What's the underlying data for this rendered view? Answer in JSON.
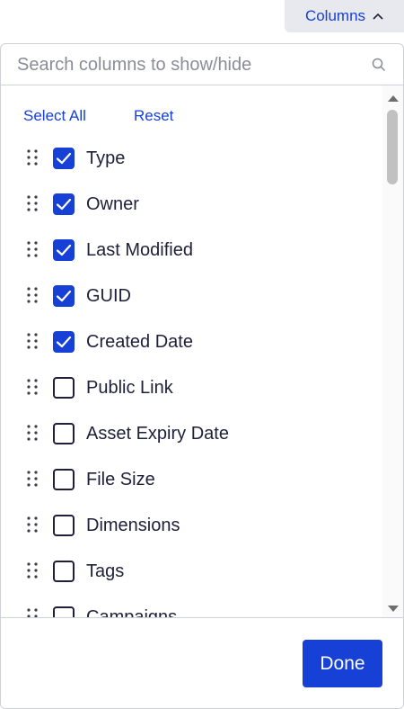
{
  "header": {
    "columns_label": "Columns"
  },
  "search": {
    "placeholder": "Search columns to show/hide",
    "value": ""
  },
  "actions": {
    "select_all": "Select All",
    "reset": "Reset"
  },
  "columns": [
    {
      "label": "Type",
      "checked": true
    },
    {
      "label": "Owner",
      "checked": true
    },
    {
      "label": "Last Modified",
      "checked": true
    },
    {
      "label": "GUID",
      "checked": true
    },
    {
      "label": "Created Date",
      "checked": true
    },
    {
      "label": "Public Link",
      "checked": false
    },
    {
      "label": "Asset Expiry Date",
      "checked": false
    },
    {
      "label": "File Size",
      "checked": false
    },
    {
      "label": "Dimensions",
      "checked": false
    },
    {
      "label": "Tags",
      "checked": false
    },
    {
      "label": "Campaigns",
      "checked": false
    }
  ],
  "footer": {
    "done_label": "Done"
  },
  "colors": {
    "accent": "#1640d6",
    "text": "#1f1f3a",
    "border": "#cfd1d8",
    "button_bg": "#e8e9ee"
  },
  "icons": {
    "toggle": "chevron-up-icon",
    "search": "search-icon",
    "drag": "drag-handle-icon",
    "check": "checkmark-icon"
  }
}
